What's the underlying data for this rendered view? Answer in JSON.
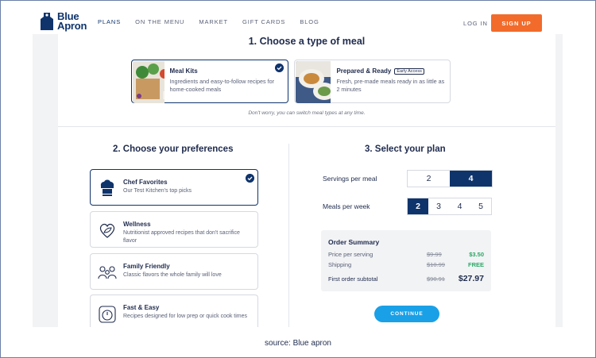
{
  "brand": {
    "logo_line1": "Blue",
    "logo_line2": "Apron",
    "navy": "#0f346c",
    "orange": "#f26b2a",
    "cyan": "#1aa0e6",
    "green": "#2aa764"
  },
  "nav": {
    "items": [
      "PLANS",
      "ON THE MENU",
      "MARKET",
      "GIFT CARDS",
      "BLOG"
    ],
    "active": "PLANS",
    "login": "LOG IN",
    "signup": "SIGN UP"
  },
  "step1": {
    "title": "1. Choose a type of meal",
    "options": [
      {
        "title": "Meal Kits",
        "desc": "Ingredients and easy-to-follow recipes for home-cooked meals",
        "selected": true
      },
      {
        "title": "Prepared & Ready",
        "badge": "Early Access",
        "desc": "Fresh, pre-made meals ready in as little as 2 minutes",
        "selected": false
      }
    ],
    "hint": "Don't worry, you can switch meal types at any time."
  },
  "step2": {
    "title": "2. Choose your preferences",
    "items": [
      {
        "title": "Chef Favorites",
        "desc": "Our Test Kitchen's top picks",
        "icon": "chef-hat-icon",
        "selected": true
      },
      {
        "title": "Wellness",
        "desc": "Nutritionist approved recipes that don't sacrifice flavor",
        "icon": "heart-leaf-icon",
        "selected": false
      },
      {
        "title": "Family Friendly",
        "desc": "Classic flavors the whole family will love",
        "icon": "family-icon",
        "selected": false
      },
      {
        "title": "Fast & Easy",
        "desc": "Recipes designed for low prep or quick cook times",
        "icon": "timer-icon",
        "selected": false
      }
    ]
  },
  "step3": {
    "title": "3. Select your plan",
    "servings_label": "Servings per meal",
    "servings": [
      "2",
      "4"
    ],
    "servings_selected": "4",
    "meals_label": "Meals per week",
    "meals": [
      "2",
      "3",
      "4",
      "5"
    ],
    "meals_selected": "2",
    "summary": {
      "title": "Order Summary",
      "price_label": "Price per serving",
      "price_old": "$9.99",
      "price_new": "$3.50",
      "shipping_label": "Shipping",
      "shipping_old": "$10.99",
      "shipping_new": "FREE",
      "subtotal_label": "First order subtotal",
      "subtotal_old": "$90.91",
      "subtotal_new": "$27.97"
    },
    "continue": "CONTINUE"
  },
  "source": "source: Blue apron"
}
